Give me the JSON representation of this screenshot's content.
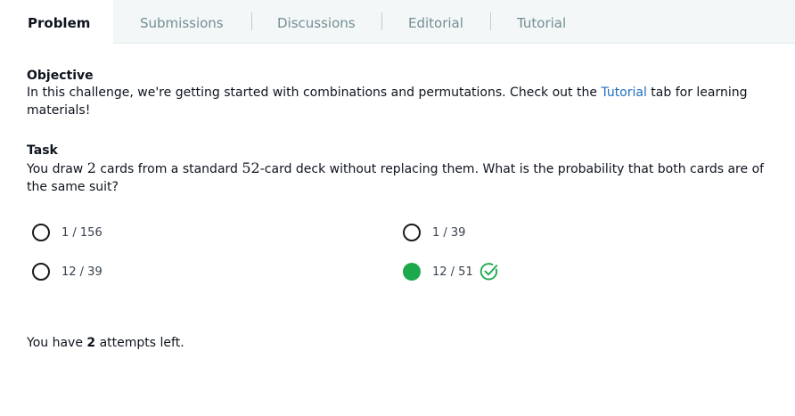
{
  "tabs": [
    {
      "label": "Problem",
      "active": true
    },
    {
      "label": "Submissions",
      "active": false
    },
    {
      "label": "Discussions",
      "active": false
    },
    {
      "label": "Editorial",
      "active": false
    },
    {
      "label": "Tutorial",
      "active": false
    }
  ],
  "objective": {
    "heading": "Objective",
    "text_before": "In this challenge, we're getting started with combinations and permutations. Check out the ",
    "link": "Tutorial",
    "text_after": " tab for learning materials!"
  },
  "task": {
    "heading": "Task",
    "text_1": "You draw ",
    "num_cards": "2",
    "text_2": " cards from a standard ",
    "deck_size": "52",
    "text_3": "-card deck without replacing them. What is the probability that both cards are of the same suit?"
  },
  "options": [
    {
      "label": "1 / 156",
      "selected": false
    },
    {
      "label": "1 / 39",
      "selected": false
    },
    {
      "label": "12 / 39",
      "selected": false
    },
    {
      "label": "12 / 51",
      "selected": true
    }
  ],
  "result": {
    "correct_icon": "check-circle-icon",
    "color": "#1ba94c"
  },
  "attempts": {
    "prefix": "You have ",
    "count": "2",
    "suffix": " attempts left."
  },
  "colors": {
    "accent": "#1ba94c",
    "link": "#1d6ebd",
    "tab_bg": "#f3f7f7",
    "tab_inactive": "#738f93"
  }
}
